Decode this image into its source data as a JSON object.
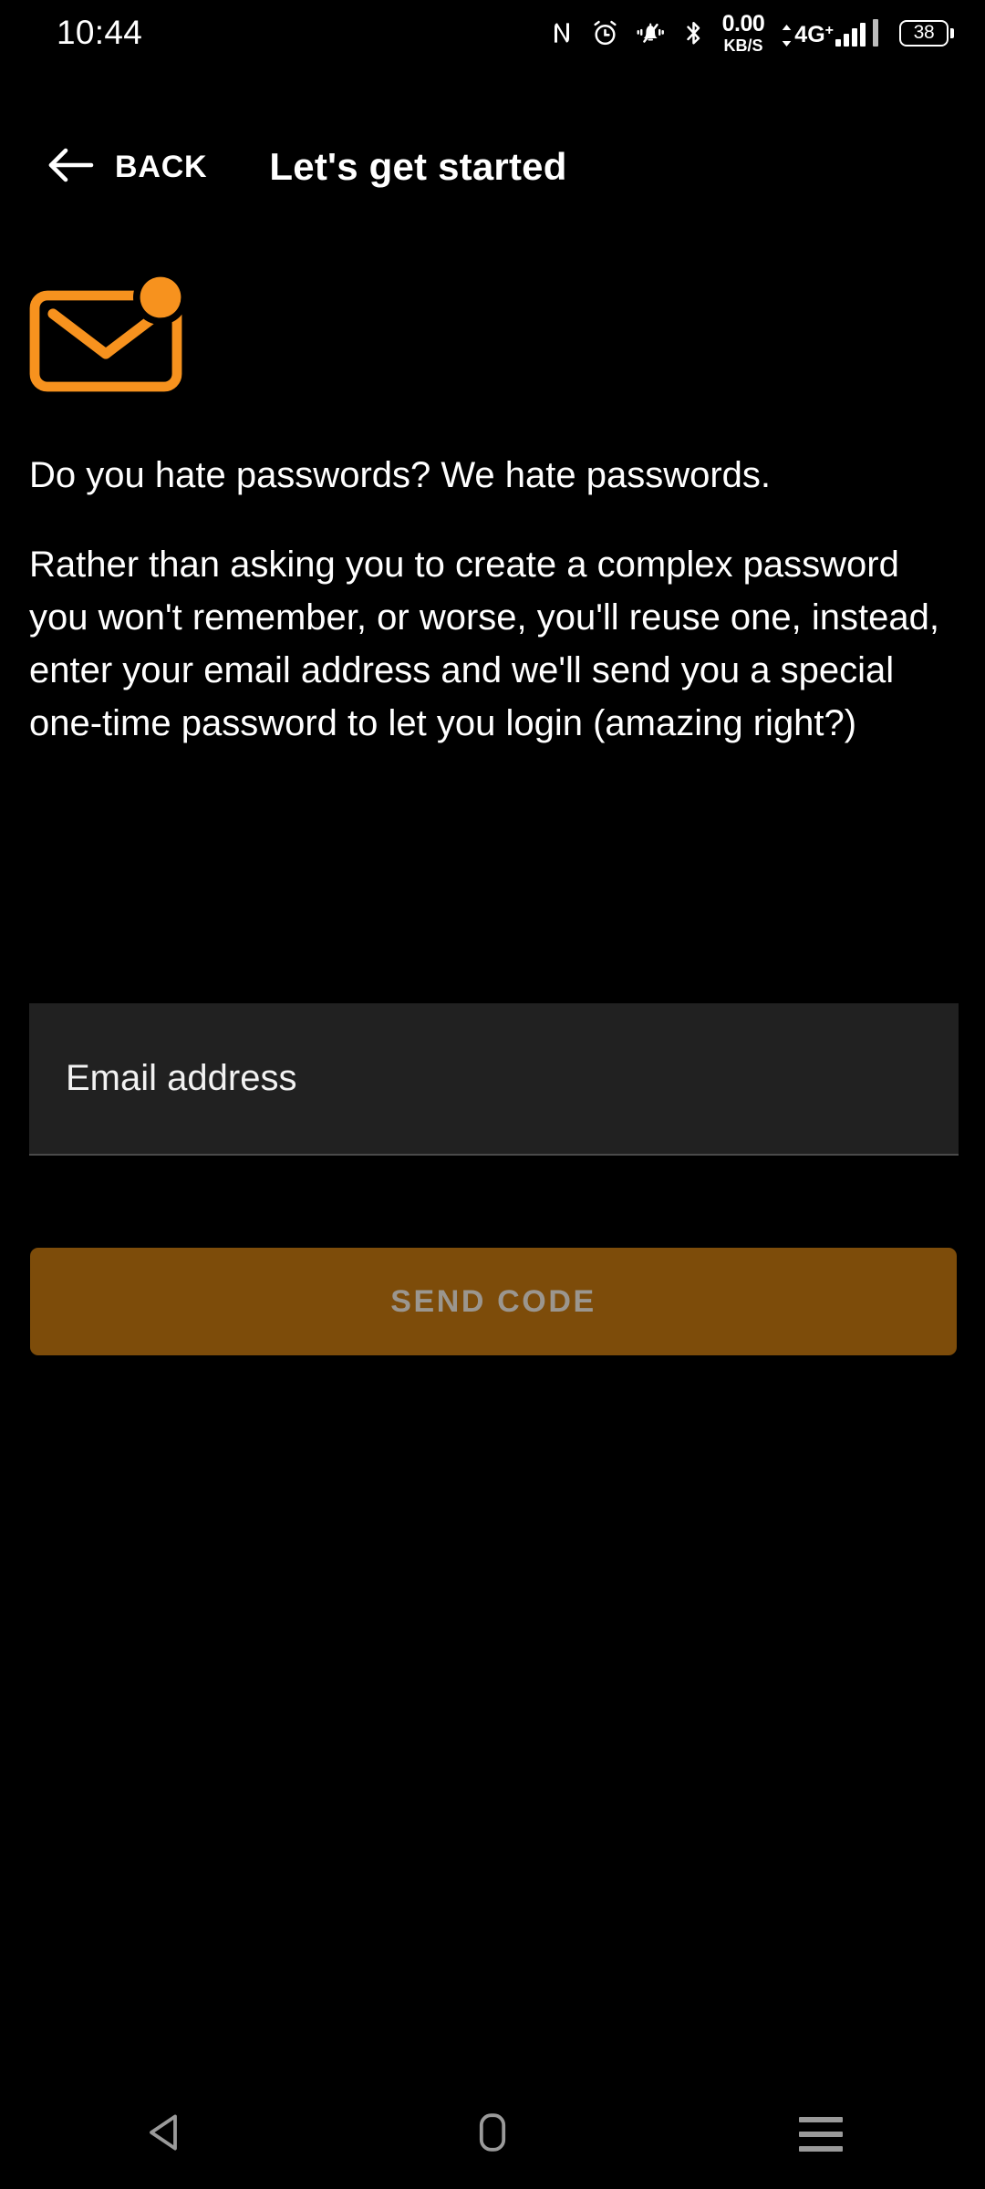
{
  "status_bar": {
    "time": "10:44",
    "network_speed_value": "0.00",
    "network_speed_unit": "KB/S",
    "network_type": "4G",
    "network_type_sup": "+",
    "battery_level": "38",
    "icons": [
      "nfc-icon",
      "alarm-icon",
      "vibrate-icon",
      "bluetooth-icon",
      "signal-icon",
      "battery-icon"
    ]
  },
  "app_bar": {
    "back_label": "BACK",
    "title": "Let's get started"
  },
  "content": {
    "icon_name": "email-notification-icon",
    "paragraph_1": "Do you hate passwords? We hate passwords.",
    "paragraph_2": "Rather than asking you to create a complex password you won't remember, or worse, you'll reuse one, instead, enter your email address and we'll send you a special one-time password to let you login (amazing right?)"
  },
  "form": {
    "email_placeholder": "Email address",
    "email_value": "",
    "submit_label": "SEND CODE"
  },
  "nav_bar": {
    "back": "back-triangle-icon",
    "home": "home-icon",
    "recents": "recents-icon"
  },
  "colors": {
    "background": "#000000",
    "accent_orange": "#F7921E",
    "button_disabled_bg": "#7D4C0A",
    "button_disabled_text": "#9B968F",
    "input_bg": "#212121",
    "text_primary": "#FFFFFF"
  }
}
